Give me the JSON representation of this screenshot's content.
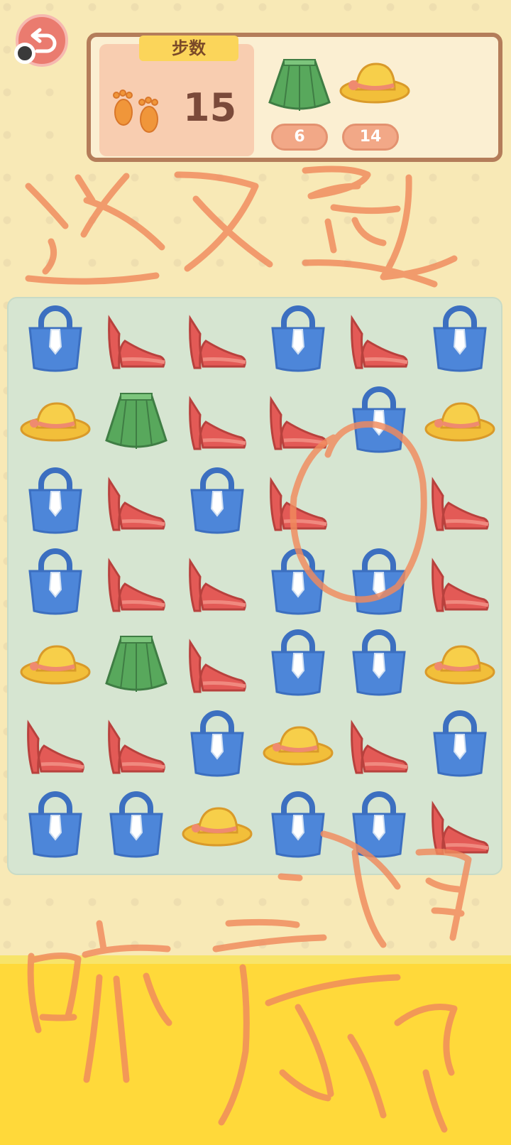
{
  "header": {
    "steps_label": "步数",
    "steps_value": "15"
  },
  "goals": [
    {
      "item": "skirt-icon",
      "count": "6"
    },
    {
      "item": "hat-icon",
      "count": "14"
    }
  ],
  "board": {
    "rows": [
      [
        "bag",
        "heel",
        "heel",
        "bag",
        "heel",
        "bag"
      ],
      [
        "hat",
        "skirt",
        "heel",
        "heel",
        "bag",
        "hat"
      ],
      [
        "bag",
        "heel",
        "bag",
        "heel",
        "",
        "heel"
      ],
      [
        "bag",
        "heel",
        "heel",
        "bag",
        "bag",
        "heel"
      ],
      [
        "hat",
        "skirt",
        "heel",
        "bag",
        "bag",
        "hat"
      ],
      [
        "heel",
        "heel",
        "bag",
        "hat",
        "heel",
        "bag"
      ],
      [
        "bag",
        "bag",
        "hat",
        "bag",
        "bag",
        "heel"
      ]
    ]
  },
  "handwriting": {
    "top": "这又是",
    "bottom": "啥意思"
  },
  "colors": {
    "bag": "#4d86d9",
    "heel": "#e35a56",
    "hat": "#f2bf3a",
    "skirt": "#58a85c",
    "annotation": "#f08a5d"
  }
}
